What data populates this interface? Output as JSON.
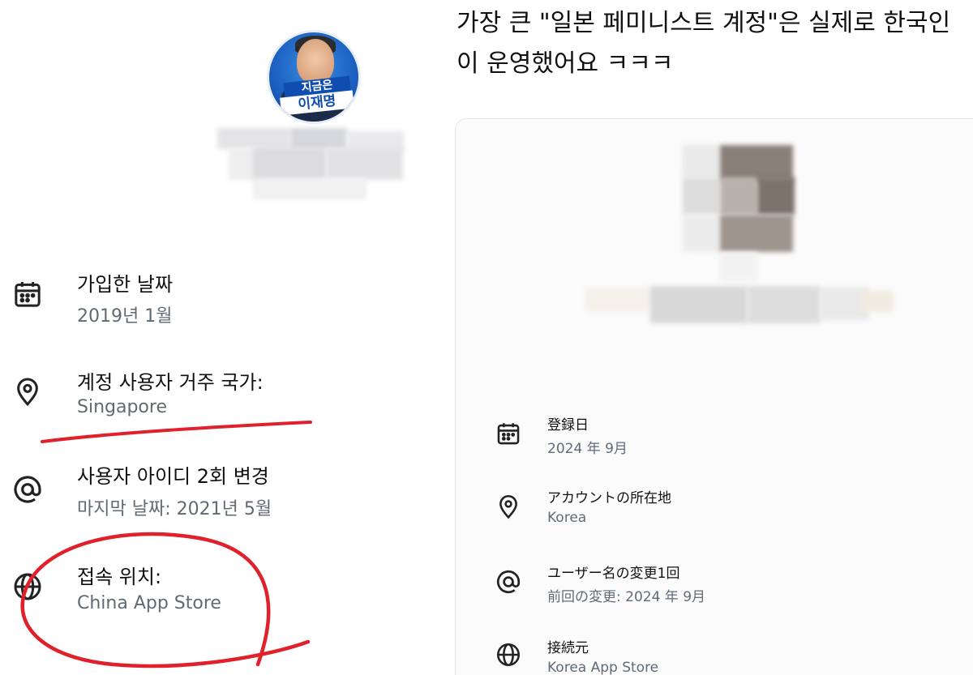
{
  "left": {
    "avatar_banner_top": "지금은",
    "avatar_banner_bottom": "이재명",
    "rows": [
      {
        "icon": "calendar-icon",
        "title": "가입한 날짜",
        "sub": "2019년 1월"
      },
      {
        "icon": "location-pin-icon",
        "title": "계정 사용자 거주 국가:",
        "sub": "Singapore"
      },
      {
        "icon": "at-sign-icon",
        "title": "사용자 아이디 2회 변경",
        "sub": "마지막 날짜: 2021년 5월"
      },
      {
        "icon": "globe-icon",
        "title": "접속 위치:",
        "sub": "China App Store"
      }
    ]
  },
  "right": {
    "headline": "가장 큰 \"일본 페미니스트 계정\"은 실제로 한국인이 운영했어요 ㅋㅋㅋ",
    "rows": [
      {
        "icon": "calendar-icon",
        "title": "登録日",
        "sub": "2024 年 9月"
      },
      {
        "icon": "location-pin-icon",
        "title": "アカウントの所在地",
        "sub": "Korea"
      },
      {
        "icon": "at-sign-icon",
        "title": "ユーザー名の変更1回",
        "sub": "前回の変更: 2024 年 9月"
      },
      {
        "icon": "globe-icon",
        "title": "接続元",
        "sub": "Korea App Store"
      }
    ]
  },
  "colors": {
    "annotation_red": "#e0202a",
    "subtext_gray": "#606a74",
    "avatar_blue": "#1b5fc0"
  }
}
